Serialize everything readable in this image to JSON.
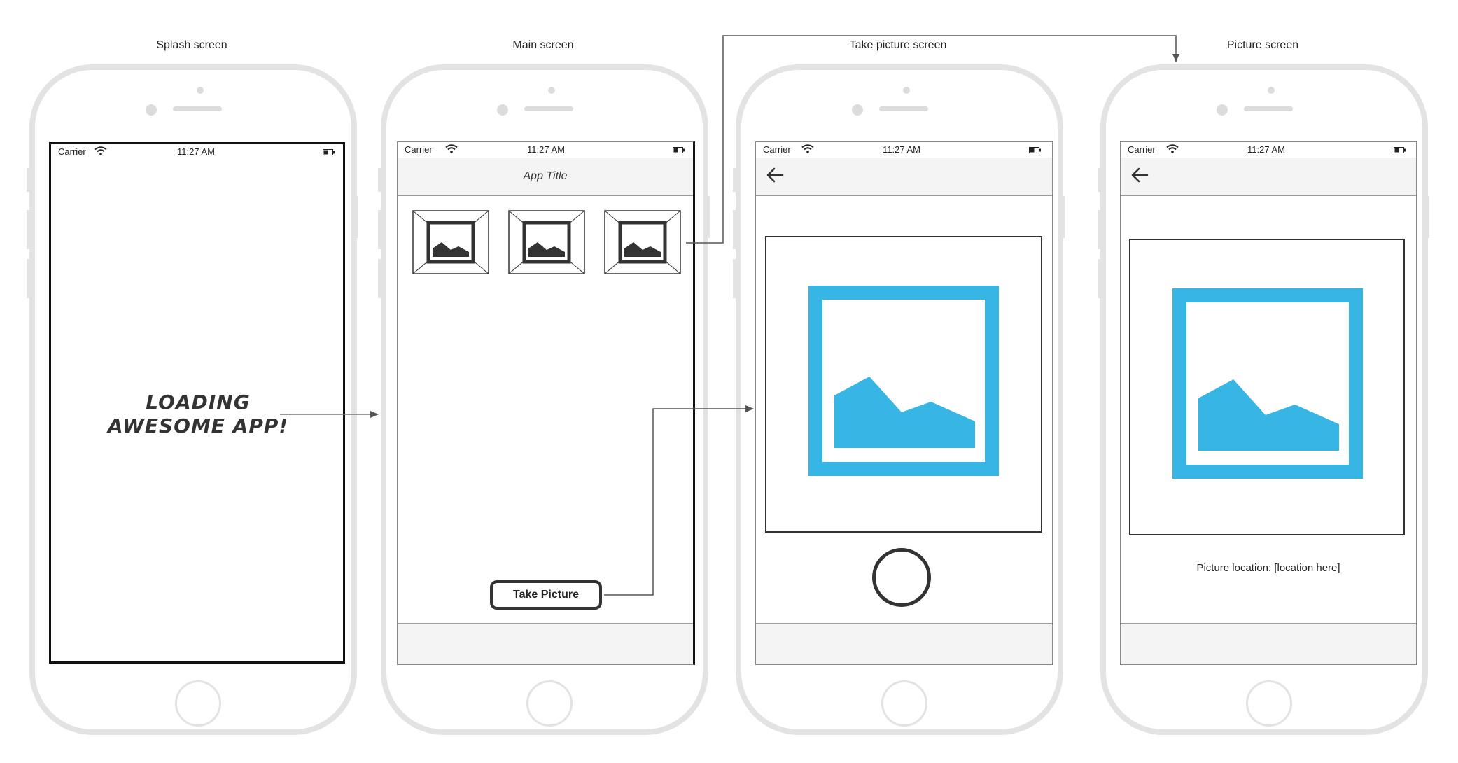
{
  "colors": {
    "image_accent": "#37b5e5",
    "outline": "#333333",
    "phone_frame": "#e3e3e3",
    "bar_bg": "#f4f4f4"
  },
  "status_bar": {
    "carrier": "Carrier",
    "time": "11:27 AM",
    "wifi_icon": "wifi-icon",
    "battery_icon": "battery-icon"
  },
  "screens": {
    "splash": {
      "label": "Splash screen",
      "loading_line1": "LOADING",
      "loading_line2": "AWESOME APP!"
    },
    "main": {
      "label": "Main screen",
      "app_title": "App Title",
      "thumbnail_icon": "image-placeholder-icon",
      "take_picture_label": "Take Picture"
    },
    "take_picture": {
      "label": "Take picture screen",
      "back_icon": "back-arrow-icon",
      "preview_icon": "image-icon",
      "shutter_icon": "shutter-button"
    },
    "picture": {
      "label": "Picture screen",
      "back_icon": "back-arrow-icon",
      "preview_icon": "image-icon",
      "location_text": "Picture location: [location here]"
    }
  },
  "connectors": [
    {
      "from": "splash",
      "to": "main"
    },
    {
      "from": "main.thumbnail",
      "to": "picture"
    },
    {
      "from": "main.take_picture_button",
      "to": "take_picture"
    }
  ]
}
